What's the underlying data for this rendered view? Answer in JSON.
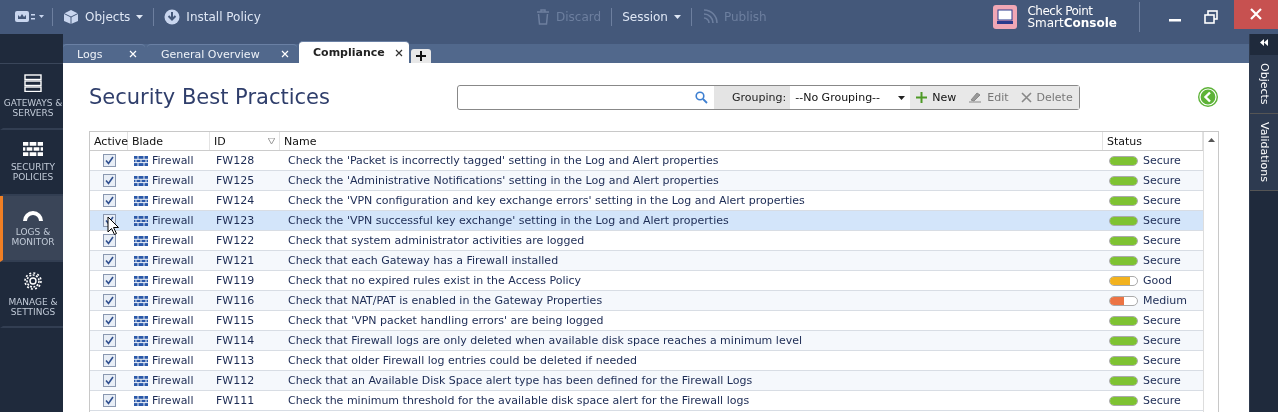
{
  "toolbar": {
    "objects": "Objects",
    "install": "Install Policy",
    "discard": "Discard",
    "session": "Session",
    "publish": "Publish",
    "brand_top": "Check Point",
    "brand_bottom_a": "Smart",
    "brand_bottom_b": "Console"
  },
  "tabs": [
    {
      "label": "Logs",
      "selected": false
    },
    {
      "label": "General Overview",
      "selected": false
    },
    {
      "label": "Compliance",
      "selected": true
    }
  ],
  "sidebar": {
    "items": [
      {
        "label": "GATEWAYS & SERVERS",
        "kind": "servers",
        "selected": false
      },
      {
        "label": "SECURITY POLICIES",
        "kind": "wall",
        "selected": false
      },
      {
        "label": "LOGS & MONITOR",
        "kind": "gauge",
        "selected": true
      },
      {
        "label": "MANAGE & SETTINGS",
        "kind": "gear",
        "selected": false
      }
    ]
  },
  "right_panel": {
    "tabs": [
      "Objects",
      "Validations"
    ]
  },
  "page": {
    "title": "Security Best Practices",
    "grouping_label": "Grouping:",
    "grouping_value": "--No Grouping--",
    "new": "New",
    "edit": "Edit",
    "delete": "Delete"
  },
  "table": {
    "columns": [
      "Active",
      "Blade",
      "ID",
      "Name",
      "Status"
    ],
    "rows": [
      {
        "active": true,
        "selected": false,
        "blade": "Firewall",
        "id": "FW128",
        "name": "Check the 'Packet is incorrectly tagged' setting in the Log and Alert properties",
        "status": "Secure",
        "level": 1,
        "color": "#7ec232"
      },
      {
        "active": true,
        "selected": false,
        "blade": "Firewall",
        "id": "FW125",
        "name": "Check the 'Administrative Notifications' setting in the Log and Alert properties",
        "status": "Secure",
        "level": 1,
        "color": "#7ec232"
      },
      {
        "active": true,
        "selected": false,
        "blade": "Firewall",
        "id": "FW124",
        "name": "Check the 'VPN configuration and key exchange errors' setting in the Log and Alert properties",
        "status": "Secure",
        "level": 1,
        "color": "#7ec232"
      },
      {
        "active": true,
        "selected": true,
        "blade": "Firewall",
        "id": "FW123",
        "name": "Check the 'VPN successful key exchange' setting in the Log and Alert properties",
        "status": "Secure",
        "level": 1,
        "color": "#7ec232"
      },
      {
        "active": true,
        "selected": false,
        "blade": "Firewall",
        "id": "FW122",
        "name": "Check that system administrator activities are logged",
        "status": "Secure",
        "level": 1,
        "color": "#7ec232"
      },
      {
        "active": true,
        "selected": false,
        "blade": "Firewall",
        "id": "FW121",
        "name": "Check that each Gateway has a Firewall installed",
        "status": "Secure",
        "level": 1,
        "color": "#7ec232"
      },
      {
        "active": true,
        "selected": false,
        "blade": "Firewall",
        "id": "FW119",
        "name": "Check that no expired rules exist in the Access Policy",
        "status": "Good",
        "level": 0.75,
        "color": "#f2b21e"
      },
      {
        "active": true,
        "selected": false,
        "blade": "Firewall",
        "id": "FW116",
        "name": "Check that NAT/PAT is enabled in the Gateway Properties",
        "status": "Medium",
        "level": 0.5,
        "color": "#ec7444"
      },
      {
        "active": true,
        "selected": false,
        "blade": "Firewall",
        "id": "FW115",
        "name": "Check that 'VPN packet handling errors' are being logged",
        "status": "Secure",
        "level": 1,
        "color": "#7ec232"
      },
      {
        "active": true,
        "selected": false,
        "blade": "Firewall",
        "id": "FW114",
        "name": "Check that Firewall logs are only deleted when available disk space reaches a minimum level",
        "status": "Secure",
        "level": 1,
        "color": "#7ec232"
      },
      {
        "active": true,
        "selected": false,
        "blade": "Firewall",
        "id": "FW113",
        "name": "Check that older Firewall log entries could be deleted if needed",
        "status": "Secure",
        "level": 1,
        "color": "#7ec232"
      },
      {
        "active": true,
        "selected": false,
        "blade": "Firewall",
        "id": "FW112",
        "name": "Check that an Available Disk Space alert type has been defined for the Firewall Logs",
        "status": "Secure",
        "level": 1,
        "color": "#7ec232"
      },
      {
        "active": true,
        "selected": false,
        "blade": "Firewall",
        "id": "FW111",
        "name": "Check the minimum threshold for the available disk space alert for the Firewall logs",
        "status": "Secure",
        "level": 1,
        "color": "#7ec232"
      }
    ]
  }
}
